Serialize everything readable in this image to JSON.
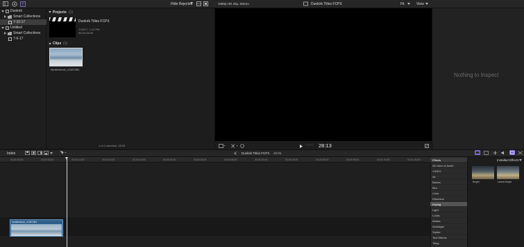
{
  "toolbar": {
    "hide_rejected": "Hide Rejected",
    "video_format": "1080p HD 25p, Stereo",
    "project_name": "Dunkirk Titles FCPX",
    "zoom": "Fit",
    "view": "View"
  },
  "sidebar": {
    "items": [
      {
        "label": "Dunkirk"
      },
      {
        "label": "Smart Collections"
      },
      {
        "label": "7-10-17"
      },
      {
        "label": "Untitled"
      },
      {
        "label": "Smart Collections"
      },
      {
        "label": "7-6-17"
      }
    ]
  },
  "browser": {
    "projects_header": "Projects",
    "projects_count": "(1)",
    "project": {
      "name": "Dunkirk Titles FCPX",
      "date": "7/18/17, 1:12 PM",
      "duration": "00:00:28:05"
    },
    "clips_header": "Clips",
    "clips_count": "(1)",
    "clip_name": "shutterstock_v1387384",
    "status": "1 of 2 selected, 28:05"
  },
  "viewer": {
    "timecode": "28:13"
  },
  "inspector": {
    "empty_text": "Nothing to Inspect"
  },
  "timeline_toolbar": {
    "index": "Index",
    "project_title": "Dunkirk Titles FCPX",
    "duration": "28:05",
    "effects_label": "Installed Effects"
  },
  "timeline": {
    "ticks": [
      "00:00:00:00",
      "00:00:05:00",
      "00:00:10:00",
      "00:00:15:00",
      "00:00:20:00",
      "00:00:25:00",
      "00:00:30:00",
      "00:00:35:00",
      "00:00:40:00",
      "00:00:45:00",
      "00:00:50:00",
      "00:00:55:00",
      "00:01:00:00",
      "00:01:05:00"
    ],
    "clip_label": "shutterstock_v1387384"
  },
  "effects": {
    "categories": [
      "Effects",
      "All Video & Audio",
      "VIDEO",
      "All",
      "Basics",
      "Blur",
      "Color",
      "Distortion",
      "Keying",
      "Light",
      "Looks",
      "Masks",
      "Nostalgia",
      "Stylize",
      "Text Effects",
      "Tiling"
    ],
    "selected": "Keying",
    "items": [
      {
        "name": "Keyer"
      },
      {
        "name": "Luma Keyer"
      }
    ]
  },
  "colors": {
    "accent": "#7b6bdc",
    "clip_blue": "#2f5f8a"
  }
}
